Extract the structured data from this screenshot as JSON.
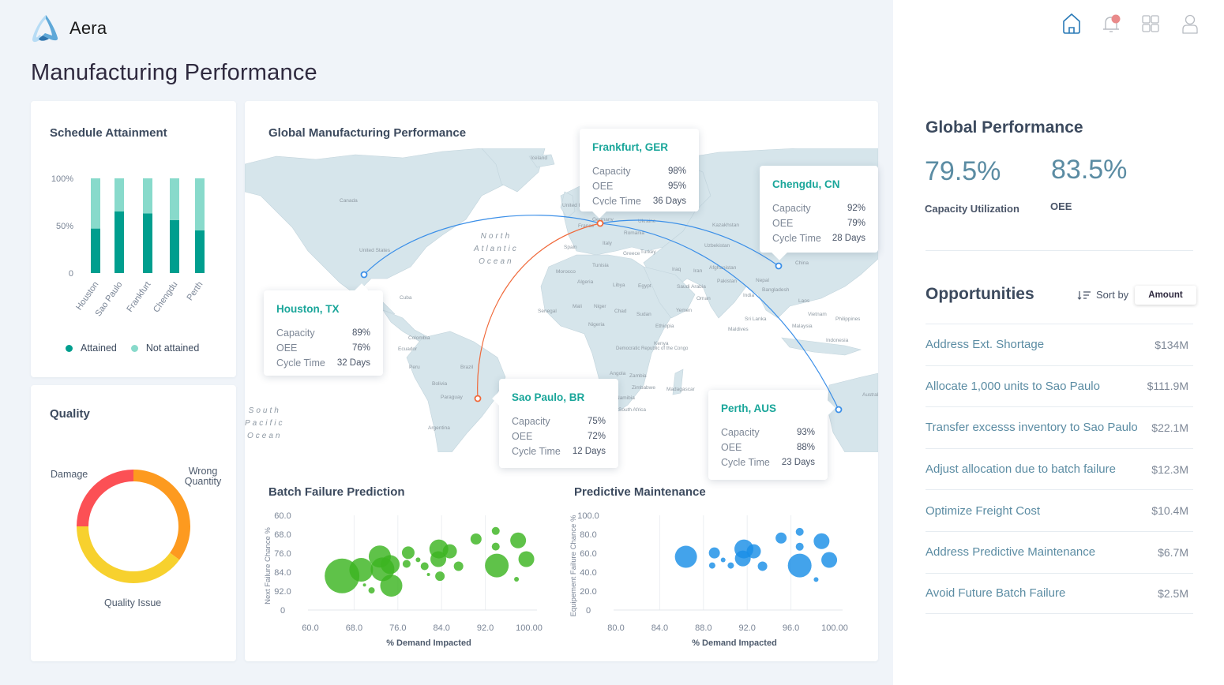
{
  "app": {
    "brand": "Aera",
    "page_title": "Manufacturing Performance"
  },
  "nav": {
    "icons": [
      {
        "name": "home-icon",
        "color": "#2a7ab7"
      },
      {
        "name": "bell-icon",
        "color": "#b8bcc2",
        "badge_color": "#e98a8a"
      },
      {
        "name": "grid-icon",
        "color": "#b8bcc2"
      },
      {
        "name": "user-icon",
        "color": "#b8bcc2"
      }
    ]
  },
  "schedule_attainment": {
    "title": "Schedule Attainment",
    "legend": {
      "attained": "Attained",
      "not_attained": "Not attained"
    },
    "colors": {
      "attained": "#009e8e",
      "not_attained": "#88dacb"
    }
  },
  "quality": {
    "title": "Quality"
  },
  "global_map": {
    "title": "Global Manufacturing Performance",
    "oceans": {
      "north_atlantic": [
        "North",
        "Atlantic",
        "Ocean"
      ],
      "south_pacific": [
        "South",
        "Pacific",
        "Ocean"
      ]
    },
    "country_labels": [
      "Iceland",
      "Canada",
      "United States",
      "Cuba",
      "Colombia",
      "Ecuador",
      "Peru",
      "Brazil",
      "Bolivia",
      "Paraguay",
      "Argentina",
      "United Kingdom",
      "Germany",
      "France",
      "Spain",
      "Italy",
      "Romania",
      "Ukraine",
      "Greece",
      "Turkey",
      "Morocco",
      "Tunisia",
      "Algeria",
      "Libya",
      "Egypt",
      "Mali",
      "Niger",
      "Chad",
      "Sudan",
      "Senegal",
      "Nigeria",
      "Ethiopia",
      "Kenya",
      "Democratic Republic of the Congo",
      "Angola",
      "Zambia",
      "Zimbabwe",
      "Namibia",
      "South Africa",
      "Madagascar",
      "Iraq",
      "Iran",
      "Saudi Arabia",
      "Oman",
      "Yemen",
      "Kazakhstan",
      "Uzbekistan",
      "Afghanistan",
      "Pakistan",
      "India",
      "Nepal",
      "Bangladesh",
      "China",
      "Laos",
      "Vietnam",
      "Philippines",
      "Malaysia",
      "Indonesia",
      "Sri Lanka",
      "Maldives",
      "Australia"
    ],
    "sites": [
      {
        "city": "Houston, TX",
        "capacity": "89%",
        "oee": "76%",
        "cycle_time": "32 Days"
      },
      {
        "city": "Frankfurt, GER",
        "capacity": "98%",
        "oee": "95%",
        "cycle_time": "36 Days"
      },
      {
        "city": "Chengdu, CN",
        "capacity": "92%",
        "oee": "79%",
        "cycle_time": "28 Days"
      },
      {
        "city": "Sao Paulo, BR",
        "capacity": "75%",
        "oee": "72%",
        "cycle_time": "12 Days"
      },
      {
        "city": "Perth, AUS",
        "capacity": "93%",
        "oee": "88%",
        "cycle_time": "23 Days"
      }
    ],
    "row_labels": {
      "capacity": "Capacity",
      "oee": "OEE",
      "cycle_time": "Cycle Time"
    },
    "route_colors": {
      "blue": "#3b8fe8",
      "orange": "#f0693a"
    }
  },
  "batch_failure": {
    "title": "Batch Failure Prediction"
  },
  "predictive_maintenance": {
    "title": "Predictive Maintenance"
  },
  "global_performance": {
    "title": "Global Performance",
    "capacity_utilization": {
      "value": "79.5%",
      "label": "Capacity Utilization"
    },
    "oee": {
      "value": "83.5%",
      "label": "OEE"
    }
  },
  "opportunities": {
    "title": "Opportunities",
    "sort_label": "Sort by",
    "sort_value": "Amount",
    "items": [
      {
        "name": "Address Ext. Shortage",
        "amount": "$134M"
      },
      {
        "name": "Allocate 1,000 units to Sao Paulo",
        "amount": "$111.9M"
      },
      {
        "name": "Transfer excesss inventory to Sao Paulo",
        "amount": "$22.1M"
      },
      {
        "name": "Adjust allocation due to batch failure",
        "amount": "$12.3M"
      },
      {
        "name": "Optimize Freight Cost",
        "amount": "$10.4M"
      },
      {
        "name": "Address Predictive Maintenance",
        "amount": "$6.7M"
      },
      {
        "name": "Avoid Future Batch Failure",
        "amount": "$2.5M"
      }
    ]
  },
  "chart_data": [
    {
      "id": "schedule",
      "type": "bar",
      "stacked": true,
      "title": "Schedule Attainment",
      "categories": [
        "Houston",
        "Sao Paulo",
        "Frankfurt",
        "Chengdu",
        "Perth"
      ],
      "series": [
        {
          "name": "Attained",
          "values": [
            47,
            65,
            63,
            56,
            45
          ],
          "color": "#009e8e"
        },
        {
          "name": "Not attained",
          "values": [
            53,
            35,
            37,
            44,
            55
          ],
          "color": "#88dacb"
        }
      ],
      "yticks": [
        "0",
        "50%",
        "100%"
      ],
      "ylim": [
        0,
        100
      ],
      "legend": "bottom"
    },
    {
      "id": "quality",
      "type": "pie",
      "donut": true,
      "title": "Quality",
      "labels": [
        "Damage",
        "Wrong Quantity",
        "Quality Issue"
      ],
      "values": [
        25,
        35,
        40
      ],
      "colors": [
        "#fc5055",
        "#fd9a1f",
        "#f7d12e"
      ]
    },
    {
      "id": "batch",
      "type": "scatter",
      "bubble": true,
      "title": "Batch Failure Prediction",
      "xlabel": "% Demand Impacted",
      "ylabel": "Next Failure Chance %",
      "xticks": [
        "60.0",
        "68.0",
        "76.0",
        "84.0",
        "92.0",
        "100.00"
      ],
      "yticks": [
        "60.0",
        "68.0",
        "76.0",
        "84.0",
        "92.0",
        "0"
      ],
      "xlim": [
        60,
        100
      ],
      "ylim": [
        60,
        100
      ],
      "y_inverted": true,
      "grid": "vertical",
      "color": "#3cb521",
      "points": [
        {
          "x": 65.8,
          "y": 85.6,
          "size": 22
        },
        {
          "x": 69.3,
          "y": 83.0,
          "size": 15
        },
        {
          "x": 72.7,
          "y": 77.4,
          "size": 14
        },
        {
          "x": 74.6,
          "y": 80.8,
          "size": 12
        },
        {
          "x": 73.2,
          "y": 82.8,
          "size": 15
        },
        {
          "x": 74.8,
          "y": 89.7,
          "size": 14
        },
        {
          "x": 69.9,
          "y": 89.4,
          "size": 2
        },
        {
          "x": 71.2,
          "y": 91.7,
          "size": 4
        },
        {
          "x": 77.9,
          "y": 75.8,
          "size": 8
        },
        {
          "x": 77.6,
          "y": 80.5,
          "size": 5
        },
        {
          "x": 79.7,
          "y": 78.8,
          "size": 3
        },
        {
          "x": 80.9,
          "y": 81.5,
          "size": 5
        },
        {
          "x": 81.6,
          "y": 85.0,
          "size": 2
        },
        {
          "x": 83.5,
          "y": 74.2,
          "size": 12
        },
        {
          "x": 83.4,
          "y": 78.5,
          "size": 10
        },
        {
          "x": 85.5,
          "y": 75.2,
          "size": 9
        },
        {
          "x": 83.7,
          "y": 85.7,
          "size": 6
        },
        {
          "x": 87.1,
          "y": 81.5,
          "size": 6
        },
        {
          "x": 90.3,
          "y": 70.0,
          "size": 7
        },
        {
          "x": 93.9,
          "y": 66.6,
          "size": 5
        },
        {
          "x": 93.9,
          "y": 73.2,
          "size": 5
        },
        {
          "x": 94.1,
          "y": 81.2,
          "size": 15
        },
        {
          "x": 98.0,
          "y": 70.6,
          "size": 10
        },
        {
          "x": 99.5,
          "y": 78.5,
          "size": 10
        },
        {
          "x": 97.7,
          "y": 87.0,
          "size": 3
        }
      ]
    },
    {
      "id": "maintenance",
      "type": "scatter",
      "bubble": true,
      "title": "Predictive Maintenance",
      "xlabel": "% Demand Impacted",
      "ylabel": "Equipement Failure Chance %",
      "xticks": [
        "80.0",
        "84.0",
        "88.0",
        "92.0",
        "96.0",
        "100.00"
      ],
      "yticks": [
        "0",
        "20.0",
        "40.0",
        "60.0",
        "80.0",
        "100.0"
      ],
      "xlim": [
        80,
        100
      ],
      "ylim": [
        0,
        100
      ],
      "grid": "vertical",
      "color": "#1a8fe6",
      "points": [
        {
          "x": 86.4,
          "y": 56.2,
          "size": 14
        },
        {
          "x": 89.0,
          "y": 60.3,
          "size": 7
        },
        {
          "x": 88.8,
          "y": 47.0,
          "size": 4
        },
        {
          "x": 89.8,
          "y": 52.9,
          "size": 3
        },
        {
          "x": 90.5,
          "y": 47.0,
          "size": 4
        },
        {
          "x": 91.7,
          "y": 64.5,
          "size": 12
        },
        {
          "x": 91.6,
          "y": 54.5,
          "size": 10
        },
        {
          "x": 92.6,
          "y": 62.0,
          "size": 9
        },
        {
          "x": 93.4,
          "y": 46.3,
          "size": 6
        },
        {
          "x": 95.1,
          "y": 76.0,
          "size": 7
        },
        {
          "x": 96.8,
          "y": 82.6,
          "size": 5
        },
        {
          "x": 96.8,
          "y": 66.9,
          "size": 5
        },
        {
          "x": 96.8,
          "y": 47.0,
          "size": 15
        },
        {
          "x": 98.8,
          "y": 72.7,
          "size": 10
        },
        {
          "x": 99.5,
          "y": 52.9,
          "size": 10
        },
        {
          "x": 98.3,
          "y": 32.2,
          "size": 3
        }
      ]
    }
  ]
}
